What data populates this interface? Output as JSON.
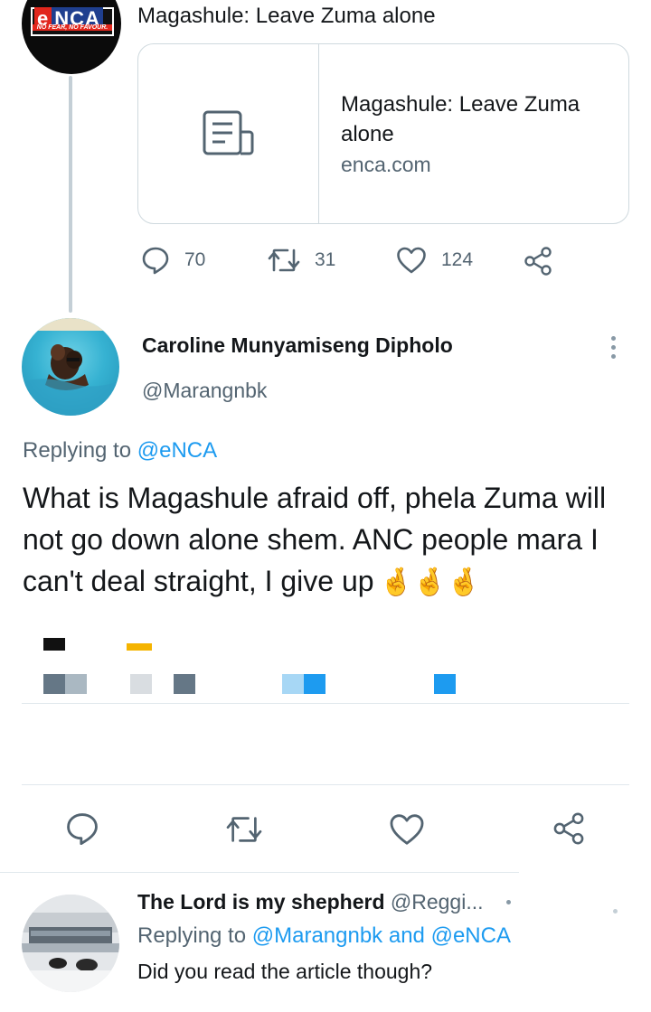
{
  "tweet1": {
    "avatar": {
      "logo_text_e": "e",
      "logo_text_nca": "NCA",
      "tagline": "NO FEAR, NO FAVOUR.",
      "icon": "enca-logo-icon"
    },
    "text": "Magashule: Leave Zuma alone",
    "card": {
      "icon": "article-icon",
      "title": "Magashule: Leave Zuma alone",
      "domain": "enca.com"
    },
    "actions": {
      "replies": "70",
      "retweets": "31",
      "likes": "124"
    }
  },
  "tweet2": {
    "name": "Caroline Munyamiseng Dipholo",
    "handle": "@Marangnbk",
    "replying_prefix": "Replying to ",
    "replying_to": "@eNCA",
    "body": "What is Magashule afraid off, phela Zuma will not go down alone shem. ANC people mara I can't deal straight, I give up",
    "emoji": "🤞🤞🤞"
  },
  "tweet3": {
    "name": "The Lord is my shepherd",
    "handle": "@Reggi...",
    "replying_prefix": "Replying to ",
    "replying_to_1": "@Marangnbk",
    "replying_and": " and ",
    "replying_to_2": "@eNCA",
    "body": "Did you read the article though?"
  },
  "colors": {
    "accent": "#1d9bf0",
    "secondary_text": "#536471",
    "border": "#cfd9de"
  }
}
